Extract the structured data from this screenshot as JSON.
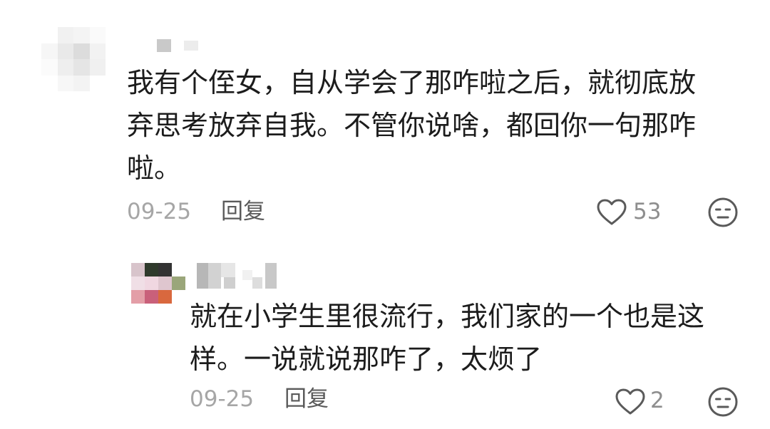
{
  "comments": [
    {
      "text": "我有个侄女，自从学会了那咋啦之后，就彻底放\n弃思考放弃自我。不管你说啥，都回你一句那咋\n啦。",
      "date": "09-25",
      "reply_label": "回复",
      "like_count": "53"
    },
    {
      "text": "就在小学生里很流行，我们家的一个也是这\n样。一说就说那咋了，太烦了",
      "date": "09-25",
      "reply_label": "回复",
      "like_count": "2"
    }
  ],
  "icons": {
    "like": "heart-outline-icon",
    "reaction": "neutral-face-icon"
  },
  "colors": {
    "text": "#1c1c1c",
    "meta": "#a6a6a6",
    "reply": "#5a5a5a",
    "icon": "#5a5a5a"
  }
}
